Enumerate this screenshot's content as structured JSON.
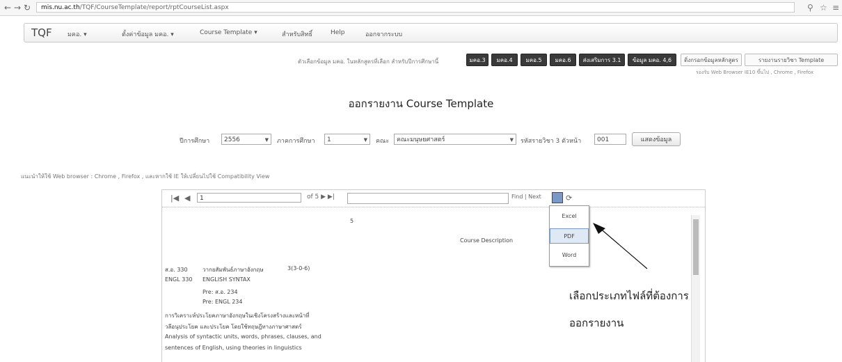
{
  "browser": {
    "url_prefix": "mis.nu.ac.th",
    "url_rest": "/TQF/CourseTemplate/report/rptCourseList.aspx"
  },
  "menu": {
    "brand": "TQF",
    "items": [
      "มคอ. ▾",
      "ตั้งค่าข้อมูล มคอ. ▾",
      "Course Template ▾",
      "สำหรับสิทธิ์",
      "Help",
      "ออกจากระบบ"
    ]
  },
  "status": {
    "note": "ตัวเลือกข้อมูล มคอ. ในหลักสูตรที่เลือก สำหรับปีการศึกษานี้",
    "buttons": [
      "มคอ.3",
      "มคอ.4",
      "มคอ.5",
      "มคอ.6",
      "ส่งเสริมการ 3.1",
      "ข้อมูล มคอ. 4,6"
    ],
    "links": [
      "ดิ่งกรอกข้อมูลหลักสูตร",
      "รายงานรายวิชา Template"
    ],
    "subnote": "รองรับ Web Browser IE10 ขึ้นไป , Chrome , Firefox"
  },
  "title": "ออกรายงาน Course Template",
  "filters": {
    "year_label": "ปีการศึกษา",
    "year_value": "2556",
    "term_label": "ภาคการศึกษา",
    "term_value": "1",
    "faculty_label": "คณะ",
    "faculty_value": "คณะมนุษยศาสตร์",
    "code_label": "รหัสรายวิชา 3 ตัวหน้า",
    "code_value": "001",
    "submit_label": "แสดงข้อมูล"
  },
  "hint": "แนะนำให้ใช้ Web browser : Chrome , Firefox , และหากใช้ IE ให้เปลี่ยนไปใช้ Compatibility View",
  "viewer": {
    "page_value": "1",
    "of_label": "of 5 ▶ ▶|",
    "find_label": "Find | Next",
    "page_number": "5",
    "export_options": [
      "Excel",
      "PDF",
      "Word"
    ],
    "section_title": "Course Description",
    "rows": [
      {
        "code": "ส.อ. 330",
        "name": "วากยสัมพันธ์ภาษาอังกฤษ",
        "credit": "3(3-0-6)"
      },
      {
        "code": "ENGL 330",
        "name": "ENGLISH SYNTAX",
        "credit": ""
      }
    ],
    "prereqs": [
      "Pre: ส.อ. 234",
      "Pre: ENGL 234"
    ],
    "desc_lines": [
      "การวิเคราะห์ประโยคภาษาอังกฤษในเชิงโครงสร้างและหน้าที่",
      "วลีอนุประโยค และประโยค โดยใช้ทฤษฎีทางภาษาศาสตร์",
      "Analysis of syntactic units, words, phrases, clauses, and",
      "sentences of English, using theories in linguistics"
    ]
  },
  "annotation": {
    "line1": "เลือกประเภทไฟล์ที่ต้องการ",
    "line2": "ออกรายงาน"
  }
}
